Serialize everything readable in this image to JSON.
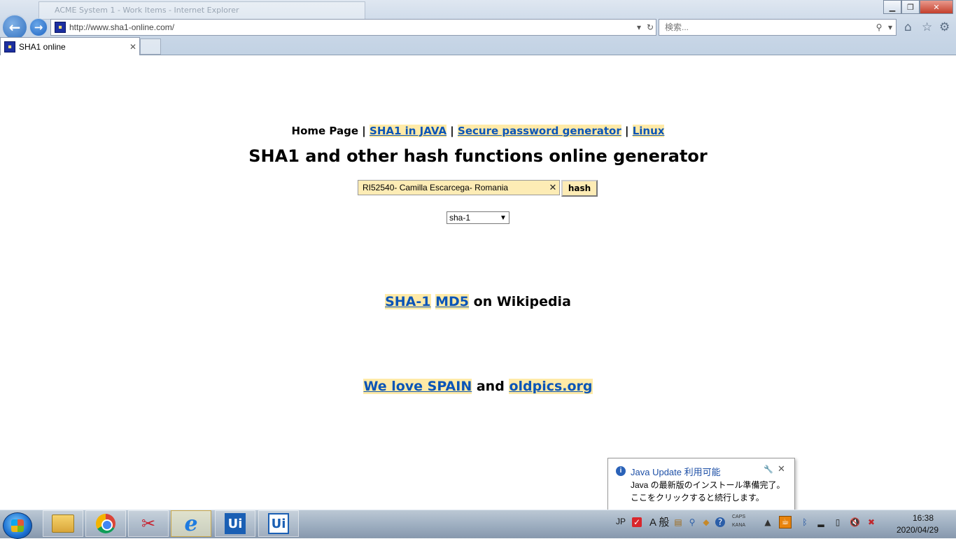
{
  "browser": {
    "background_window_title": "ACME System 1 - Work Items - Internet Explorer",
    "address": {
      "url": "http://www.sha1-online.com/"
    },
    "search": {
      "placeholder": "検索..."
    },
    "tabs": [
      {
        "label": "SHA1 online"
      }
    ]
  },
  "page": {
    "nav": {
      "home": "Home Page",
      "sep": "|",
      "sha1_java": "SHA1 in JAVA",
      "password_generator": "Secure password generator",
      "linux": "Linux"
    },
    "title": "SHA1 and other hash functions online generator",
    "form": {
      "input_value": "RI52540- Camilla Escarcega- Romania",
      "hash_button": "hash",
      "algorithm_selected": "sha-1"
    },
    "wiki": {
      "sha1_link": "SHA-1",
      "md5_link": "MD5",
      "suffix": "on Wikipedia"
    },
    "footer_links": {
      "spain_link": "We love SPAIN",
      "and": "and",
      "oldpics_link": "oldpics.org"
    }
  },
  "notification": {
    "title": "Java Update 利用可能",
    "line1": "Java の最新版のインストール準備完了。",
    "line2": "ここをクリックすると続行します。"
  },
  "taskbar": {
    "language": "JP",
    "ime_mode": "A 般",
    "caps": "CAPS",
    "kana": "KANA",
    "clock": {
      "time": "16:38",
      "date": "2020/04/29"
    }
  },
  "colors": {
    "link": "#0b55b7",
    "link_highlight": "#ffeaa7",
    "input_bg": "#fdecb5"
  }
}
